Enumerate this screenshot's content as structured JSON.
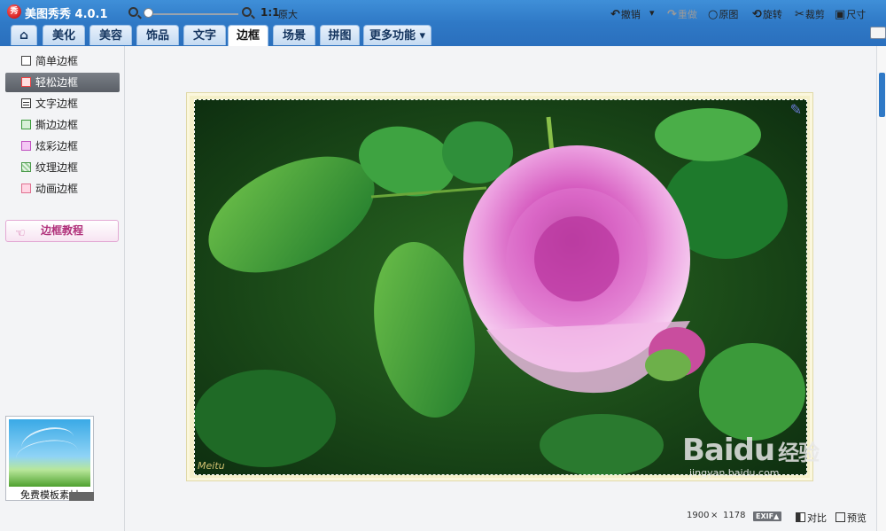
{
  "app": {
    "title": "美图秀秀 4.0.1",
    "logo_text": "秀"
  },
  "tabs": [
    {
      "id": "home",
      "label": "⌂"
    },
    {
      "id": "beautify",
      "label": "美化"
    },
    {
      "id": "makeup",
      "label": "美容"
    },
    {
      "id": "accessories",
      "label": "饰品"
    },
    {
      "id": "text",
      "label": "文字"
    },
    {
      "id": "border",
      "label": "边框",
      "active": true
    },
    {
      "id": "scene",
      "label": "场景"
    },
    {
      "id": "collage",
      "label": "拼图"
    },
    {
      "id": "more",
      "label": "更多功能 ▾"
    }
  ],
  "sidebar": {
    "items": [
      {
        "label": "简单边框",
        "icon": "square-icon"
      },
      {
        "label": "轻松边框",
        "icon": "frame-icon",
        "active": true
      },
      {
        "label": "文字边框",
        "icon": "text-frame-icon"
      },
      {
        "label": "撕边边框",
        "icon": "torn-frame-icon"
      },
      {
        "label": "炫彩边框",
        "icon": "color-frame-icon"
      },
      {
        "label": "纹理边框",
        "icon": "texture-frame-icon"
      },
      {
        "label": "动画边框",
        "icon": "animation-frame-icon"
      }
    ],
    "tutorial_label": "边框教程",
    "template_label": "免费模板素材"
  },
  "toolbar": {
    "zoom_level": 0,
    "zoom_11": "1:1",
    "zoom_orig": "原大",
    "undo": "撤销",
    "redo": "重做",
    "original": "原图",
    "rotate": "旋转",
    "crop": "裁剪",
    "size": "尺寸"
  },
  "status": {
    "width": "1900",
    "times": "×",
    "height": "1178",
    "exif": "EXIF▲",
    "compare": "对比",
    "preview": "预览"
  },
  "photo": {
    "signature": "Meitu",
    "watermark": "Baidu",
    "watermark_cn": "经验",
    "watermark_url": "jingyan.baidu.com"
  },
  "colors": {
    "accent": "#2f79c6",
    "frame": "#f5f0c9",
    "rose": "#e58ad6"
  }
}
